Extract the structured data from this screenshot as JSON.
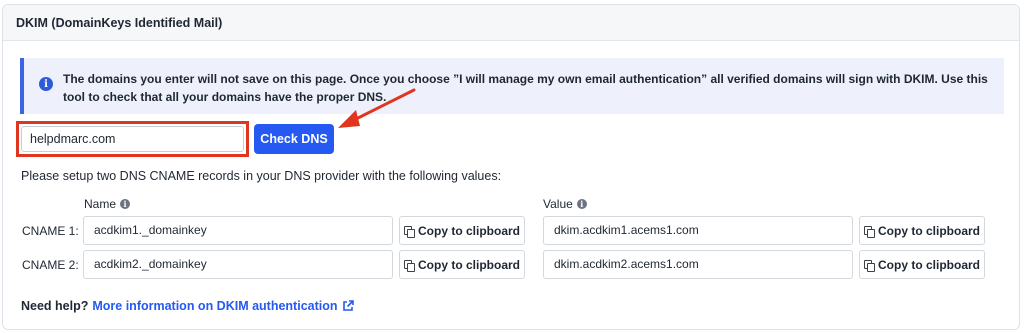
{
  "panel": {
    "title": "DKIM (DomainKeys Identified Mail)"
  },
  "info": {
    "icon": "info-icon",
    "text": "The domains you enter will not save on this page. Once you choose ”I will manage my own email authentication” all verified domains will sign with DKIM. Use this tool to check that all your domains have the proper DNS."
  },
  "domain": {
    "value": "helpdmarc.com"
  },
  "check_button": {
    "label": "Check DNS"
  },
  "setup_text": "Please setup two DNS CNAME records in your DNS provider with the following values:",
  "columns": {
    "name": "Name",
    "value": "Value"
  },
  "records": [
    {
      "label": "CNAME 1:",
      "name": "acdkim1._domainkey",
      "value": "dkim.acdkim1.acems1.com",
      "copy_label": "Copy to clipboard"
    },
    {
      "label": "CNAME 2:",
      "name": "acdkim2._domainkey",
      "value": "dkim.acdkim2.acems1.com",
      "copy_label": "Copy to clipboard"
    }
  ],
  "help": {
    "label": "Need help?",
    "link": "More information on DKIM authentication"
  },
  "colors": {
    "accent": "#2559f2",
    "highlight": "#e0351f",
    "info_bg": "#eef1fb"
  }
}
